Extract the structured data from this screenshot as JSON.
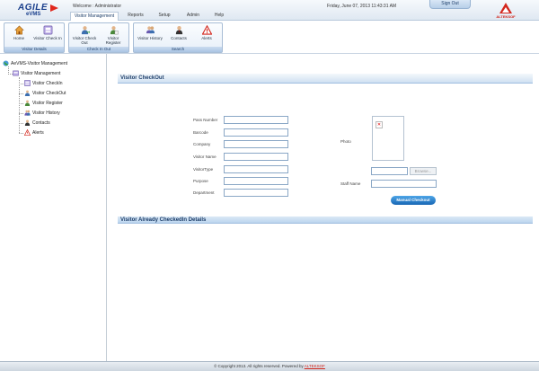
{
  "header": {
    "logo_line1": "AGILE",
    "logo_line2": "eVMS",
    "welcome": "Welcome : Administrator",
    "datetime": "Friday, June 07, 2013   11:43:31 AM",
    "signout": "Sign Out",
    "brand": "ALTEKSOF",
    "nav": [
      "Visitor Management",
      "Reports",
      "Setup",
      "Admin",
      "Help"
    ]
  },
  "ribbon": {
    "groups": [
      {
        "label": "Visitor Details",
        "buttons": [
          {
            "label": "Home",
            "icon": "home-icon"
          },
          {
            "label": "Visitor Check In",
            "icon": "checkin-icon"
          }
        ]
      },
      {
        "label": "Check In Out",
        "buttons": [
          {
            "label": "Visitor Check Out",
            "icon": "checkout-icon"
          },
          {
            "label": "Visitor Register",
            "icon": "register-icon"
          }
        ]
      },
      {
        "label": "Search",
        "buttons": [
          {
            "label": "Visitor History",
            "icon": "history-icon"
          },
          {
            "label": "Contacts",
            "icon": "contacts-icon"
          },
          {
            "label": "Alerts",
            "icon": "alert-icon"
          }
        ]
      }
    ]
  },
  "sidebar": {
    "root": "AeVMS-Visitor Management",
    "group": "Visitor Management",
    "items": [
      "Visitor CheckIn",
      "Visitor CheckOut",
      "Visitor Register",
      "Visitor History",
      "Contacts",
      "Alerts"
    ]
  },
  "main": {
    "title": "Visitor CheckOut",
    "fields": [
      {
        "label": "Pass Number",
        "value": ""
      },
      {
        "label": "Barcode",
        "value": ""
      },
      {
        "label": "Company",
        "value": ""
      },
      {
        "label": "Visitor Name",
        "value": ""
      },
      {
        "label": "VisitorType",
        "value": ""
      },
      {
        "label": "Purpose",
        "value": ""
      },
      {
        "label": "Department",
        "value": ""
      }
    ],
    "photo_label": "Photo",
    "browse_label": "Browse...",
    "staff_label": "Staff Name",
    "button_label": "Manual Checkout",
    "section2_title": "Visitor Already CheckedIn Details"
  },
  "footer": {
    "text": "© Copyright 2013. All rights reserved. Powered by",
    "brand": "ALTEKSOF"
  },
  "colors": {
    "accent": "#1d3e6a",
    "brand_red": "#d3261c",
    "button_blue": "#1766b4"
  }
}
